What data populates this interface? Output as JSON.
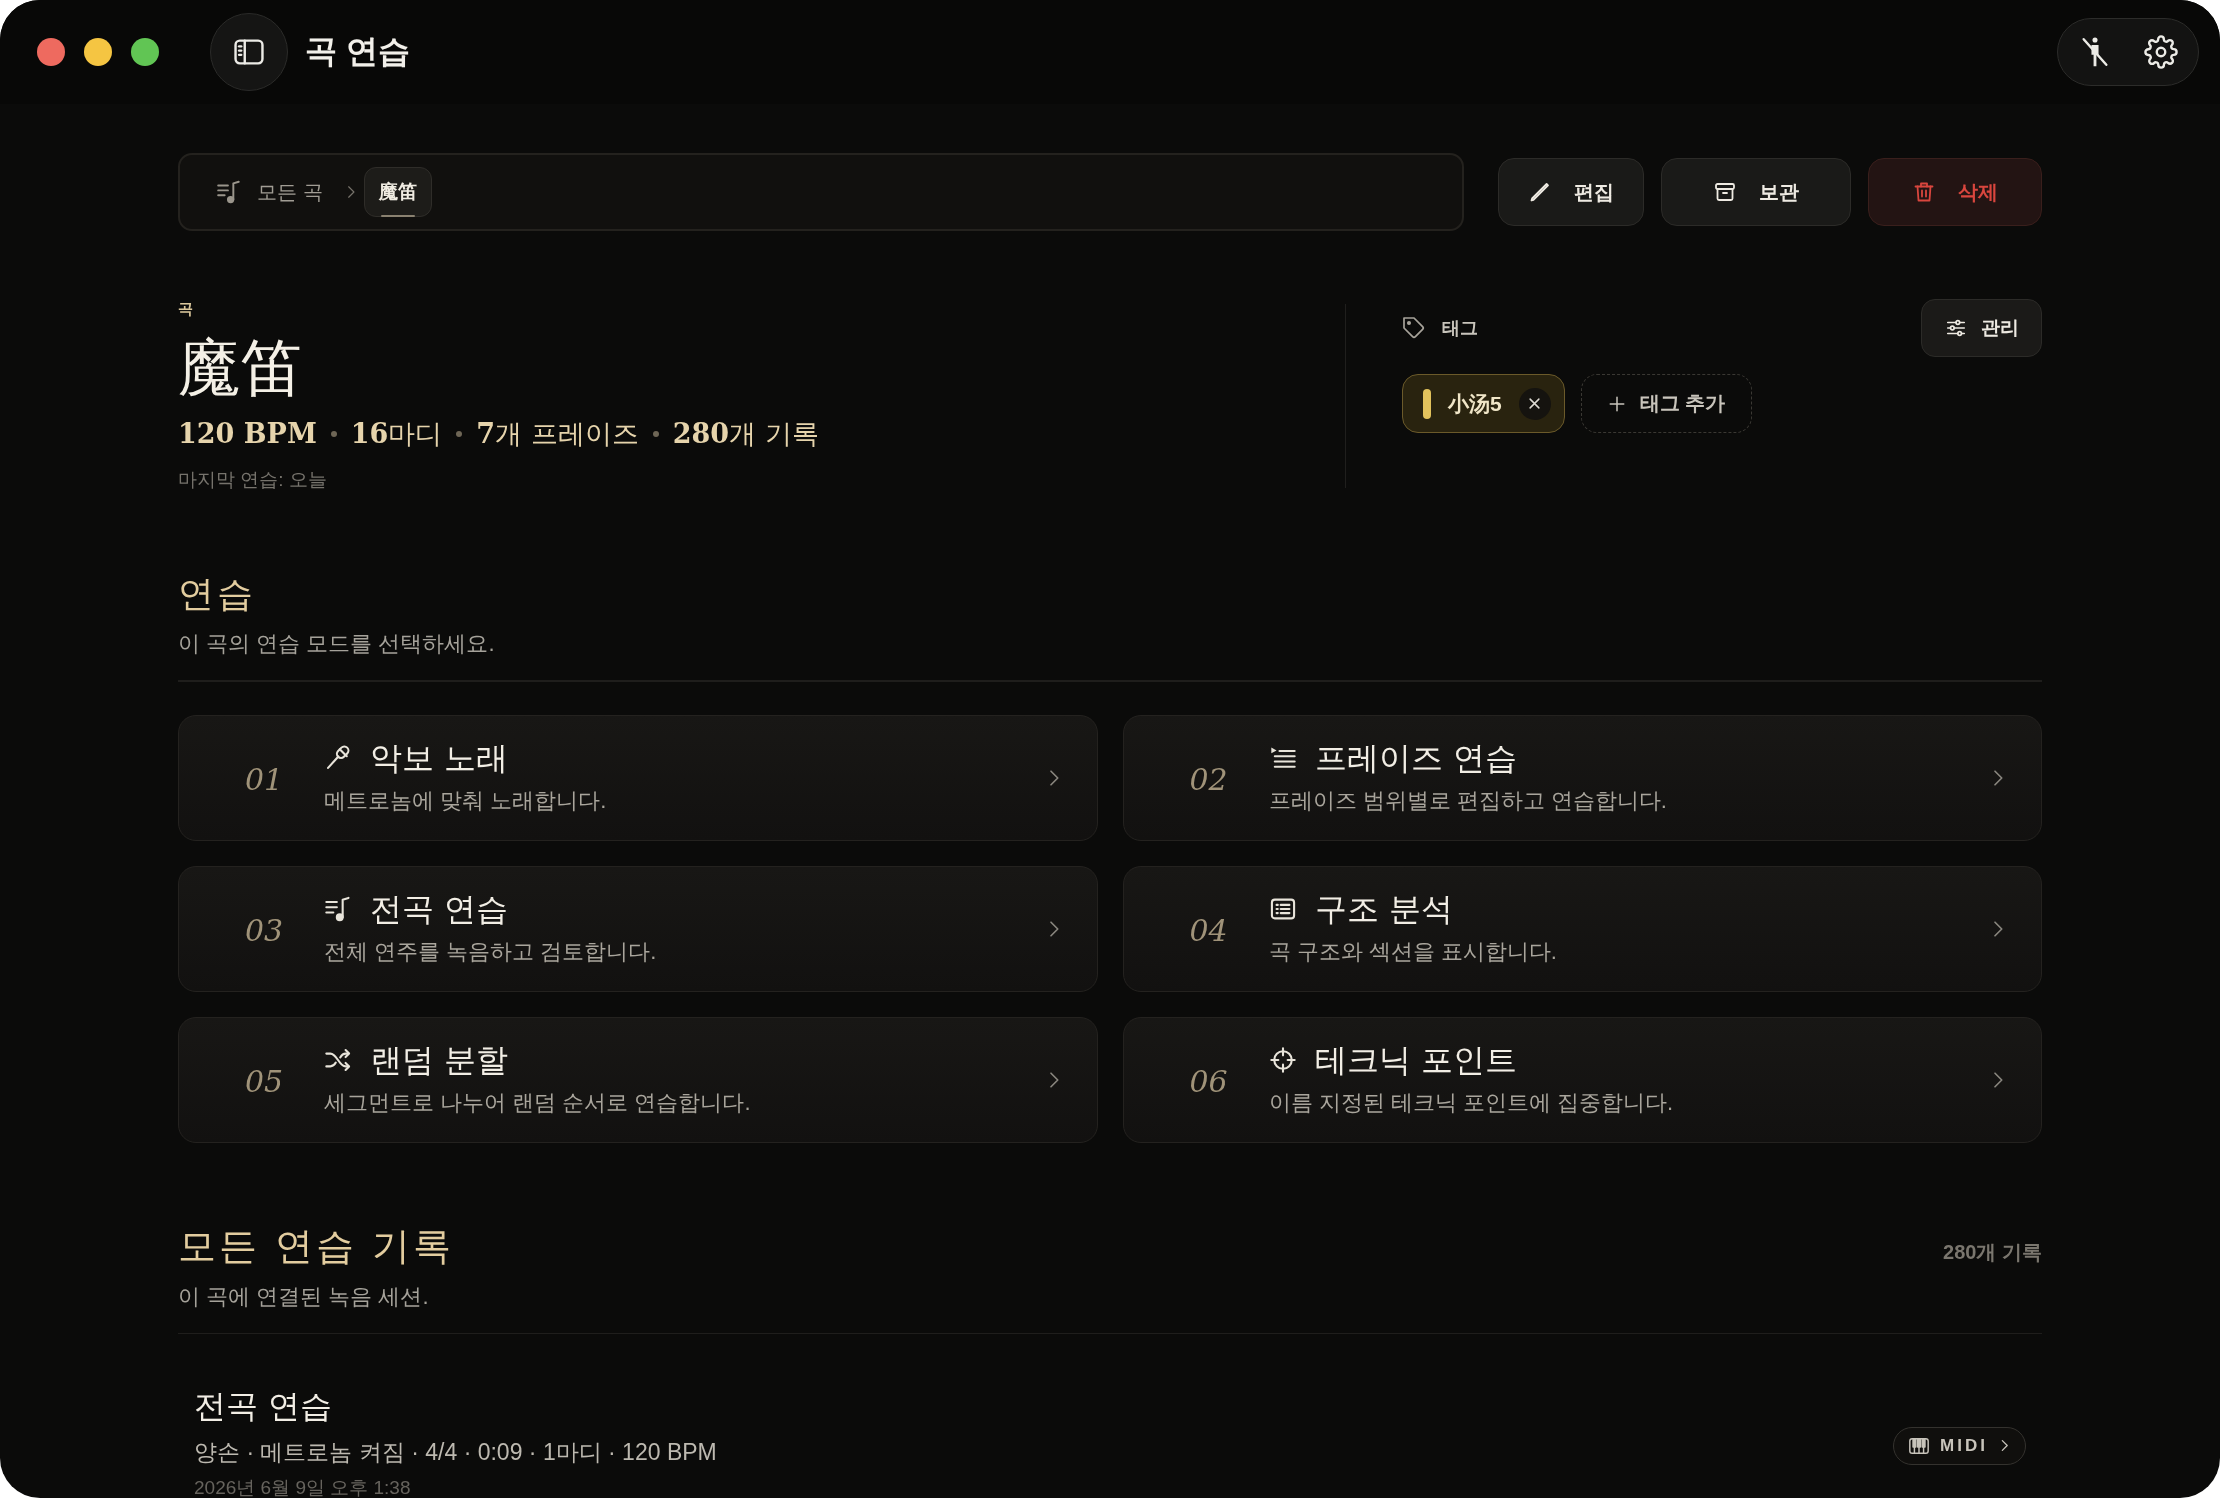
{
  "window": {
    "title": "곡 연습"
  },
  "breadcrumb": [
    {
      "label": "모든 곡",
      "selected": false
    },
    {
      "label": "魔笛",
      "selected": true
    }
  ],
  "actions": [
    {
      "kind": "edit",
      "label": "편집"
    },
    {
      "kind": "archive",
      "label": "보관"
    },
    {
      "kind": "delete",
      "label": "삭제"
    }
  ],
  "song": {
    "eyebrow": "곡",
    "title": "魔笛",
    "stats": [
      {
        "value": "120 BPM"
      },
      {
        "value": "16",
        "unit": "마디"
      },
      {
        "value": "7",
        "unit": "개 프레이즈"
      },
      {
        "value": "280",
        "unit": "개 기록"
      }
    ],
    "last_practice": "마지막 연습: 오늘"
  },
  "tags": {
    "label": "태그",
    "manage": "관리",
    "items": [
      {
        "label": "小汤5",
        "color": "#e2c25c"
      }
    ],
    "add": "태그 추가"
  },
  "practice": {
    "title": "연습",
    "subtitle": "이 곡의 연습 모드를 선택하세요.",
    "modes": [
      {
        "number": "01",
        "kind": "sing",
        "title": "악보 노래",
        "description": "메트로놈에 맞춰 노래합니다."
      },
      {
        "number": "02",
        "kind": "phrase",
        "title": "프레이즈 연습",
        "description": "프레이즈 범위별로 편집하고 연습합니다."
      },
      {
        "number": "03",
        "kind": "full",
        "title": "전곡 연습",
        "description": "전체 연주를 녹음하고 검토합니다."
      },
      {
        "number": "04",
        "kind": "structure",
        "title": "구조 분석",
        "description": "곡 구조와 섹션을 표시합니다."
      },
      {
        "number": "05",
        "kind": "random",
        "title": "랜덤 분할",
        "description": "세그먼트로 나누어 랜덤 순서로 연습합니다."
      },
      {
        "number": "06",
        "kind": "technique",
        "title": "테크닉 포인트",
        "description": "이름 지정된 테크닉 포인트에 집중합니다."
      }
    ]
  },
  "records": {
    "title": "모든 연습 기록",
    "count": "280개 기록",
    "subtitle": "이 곡에 연결된 녹음 세션.",
    "items": [
      {
        "title": "전곡 연습",
        "meta": "양손 · 메트로놈 켜짐 · 4/4 · 0:09 · 1마디 · 120 BPM",
        "date": "2026년 6월 9일 오후 1:38",
        "badge": "MIDI"
      }
    ]
  }
}
